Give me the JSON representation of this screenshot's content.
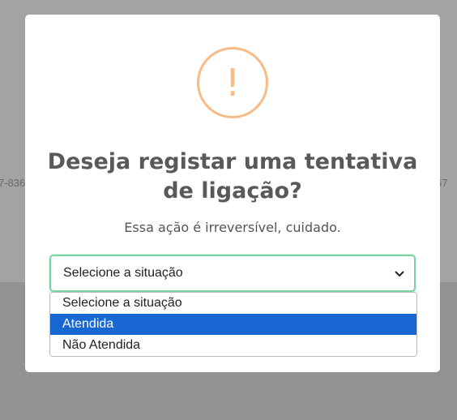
{
  "background": {
    "left_fragment": "7-836",
    "right_fragment": "67"
  },
  "dialog": {
    "icon": "exclamation-icon",
    "icon_glyph": "!",
    "icon_color": "#f8bb86",
    "title": "Deseja registar uma tentativa de ligação?",
    "subtitle": "Essa ação é irreversível, cuidado."
  },
  "select": {
    "value": "Selecione a situação",
    "focus_border_color": "#7ad3a5",
    "options": [
      {
        "label": "Selecione a situação",
        "highlighted": false
      },
      {
        "label": "Atendida",
        "highlighted": true
      },
      {
        "label": "Não Atendida",
        "highlighted": false
      }
    ],
    "highlight_color": "#1967d2"
  }
}
